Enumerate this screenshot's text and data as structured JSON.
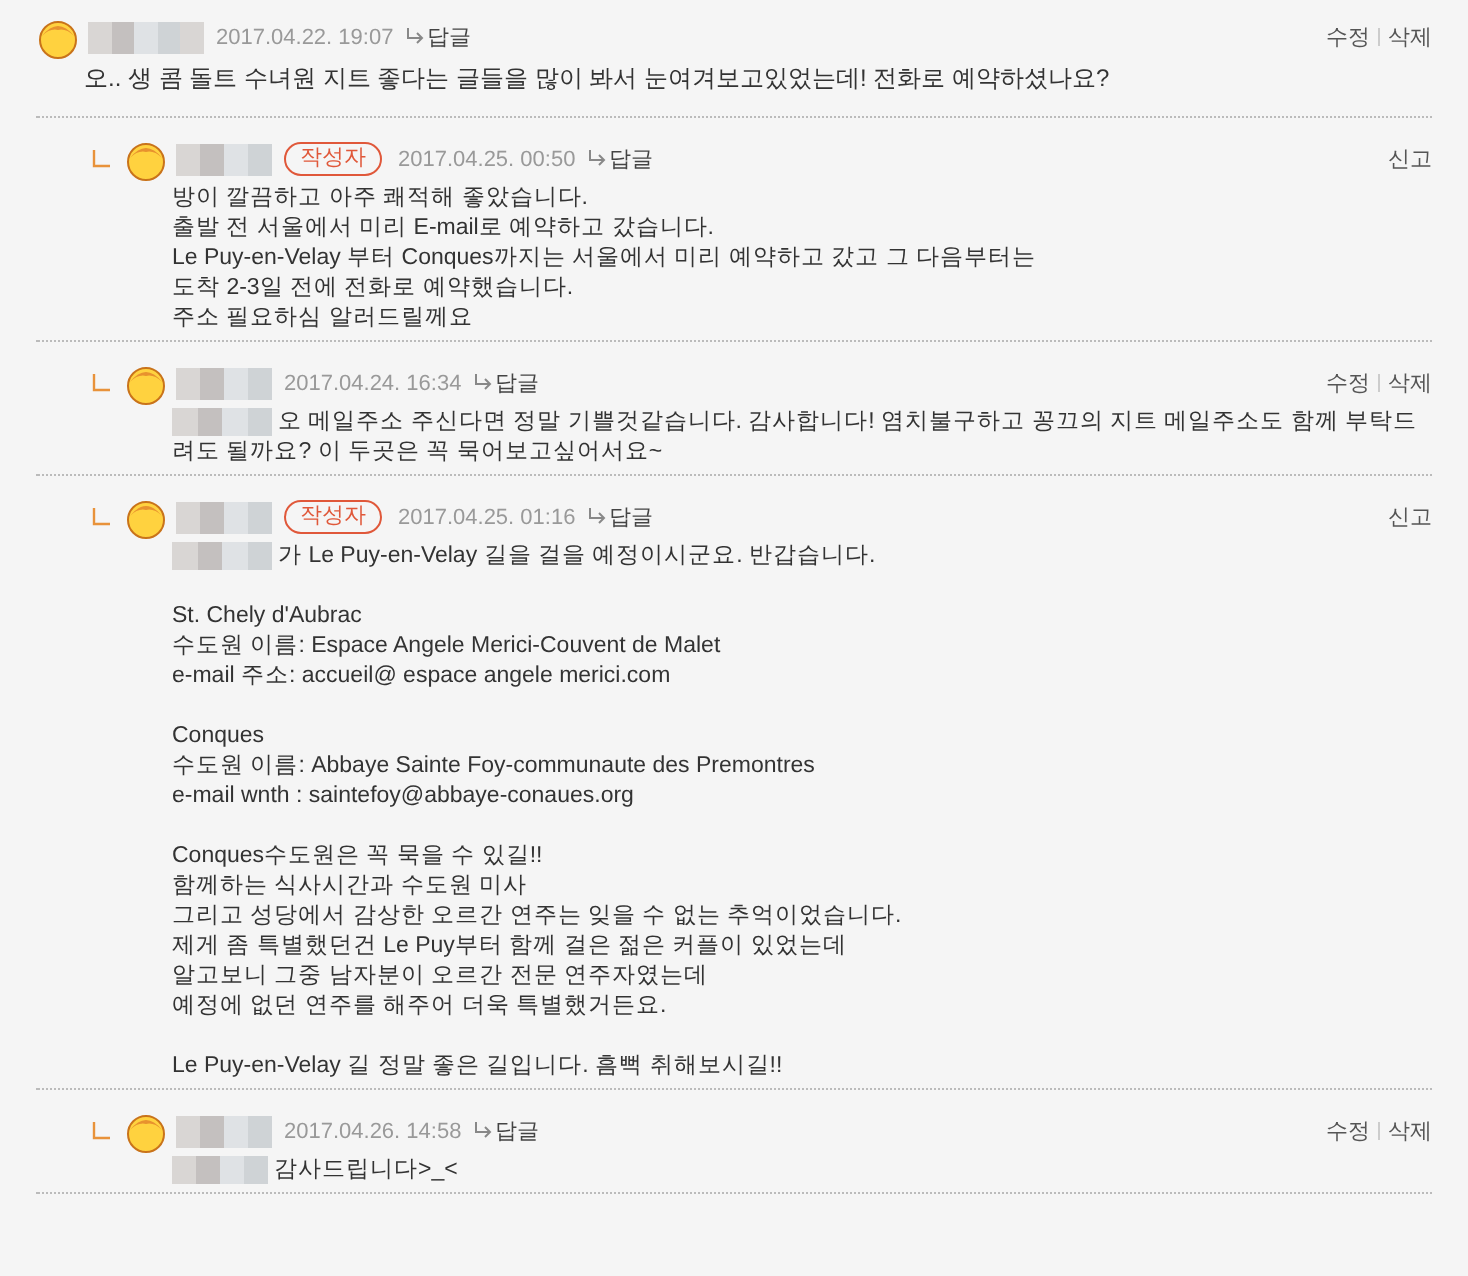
{
  "comments": [
    {
      "author_badge": false,
      "date": "2017.04.22. 19:07",
      "reply_label": "답글",
      "actions": [
        "수정",
        "삭제"
      ],
      "mention": false,
      "paragraphs": [
        [
          "오.. 생 콤 돌트 수녀원 지트 좋다는 글들을 많이 봐서 눈여겨보고있었는데! 전화로 예약하셨나요?"
        ]
      ],
      "children": [
        {
          "author_badge": true,
          "badge": "작성자",
          "date": "2017.04.25. 00:50",
          "reply_label": "답글",
          "actions": [
            "신고"
          ],
          "mention": false,
          "paragraphs": [
            [
              "방이 깔끔하고 아주 쾌적해 좋았습니다.",
              "출발 전 서울에서 미리 E-mail로 예약하고 갔습니다.",
              "Le Puy-en-Velay 부터 Conques까지는 서울에서 미리 예약하고 갔고 그 다음부터는",
              "도착 2-3일 전에 전화로 예약했습니다.",
              "주소 필요하심 알러드릴께요"
            ]
          ]
        },
        {
          "author_badge": false,
          "date": "2017.04.24. 16:34",
          "reply_label": "답글",
          "actions": [
            "수정",
            "삭제"
          ],
          "mention": true,
          "paragraphs": [
            [
              "오 메일주소 주신다면 정말 기쁠것같습니다. 감사합니다! 염치불구하고 꽁끄의 지트 메일주소도 함께 부탁드려도 될까요? 이 두곳은 꼭 묵어보고싶어서요~"
            ]
          ]
        },
        {
          "author_badge": true,
          "badge": "작성자",
          "date": "2017.04.25. 01:16",
          "reply_label": "답글",
          "actions": [
            "신고"
          ],
          "mention": true,
          "paragraphs": [
            [
              "가 Le Puy-en-Velay 길을 걸을 예정이시군요. 반갑습니다."
            ],
            [
              "St. Chely d'Aubrac",
              "수도원 이름: Espace Angele Merici-Couvent de Malet",
              "e-mail 주소: accueil@ espace angele merici.com"
            ],
            [
              "Conques",
              "수도원 이름: Abbaye Sainte Foy-communaute des Premontres",
              "e-mail wnth : saintefoy@abbaye-conaues.org"
            ],
            [
              "Conques수도원은 꼭 묵을 수 있길!!",
              "함께하는 식사시간과 수도원 미사",
              "그리고 성당에서 감상한 오르간 연주는 잊을 수 없는 추억이었습니다.",
              "제게 좀 특별했던건 Le Puy부터 함께 걸은 젊은 커플이 있었는데",
              "알고보니 그중 남자분이 오르간 전문 연주자였는데",
              "예정에 없던 연주를 해주어 더욱 특별했거든요."
            ],
            [
              "Le Puy-en-Velay 길 정말 좋은 길입니다. 흠뻑 취해보시길!!"
            ]
          ]
        },
        {
          "author_badge": false,
          "date": "2017.04.26. 14:58",
          "reply_label": "답글",
          "actions": [
            "수정",
            "삭제"
          ],
          "mention": true,
          "paragraphs": [
            [
              "감사드립니다>_<"
            ]
          ]
        }
      ]
    }
  ]
}
